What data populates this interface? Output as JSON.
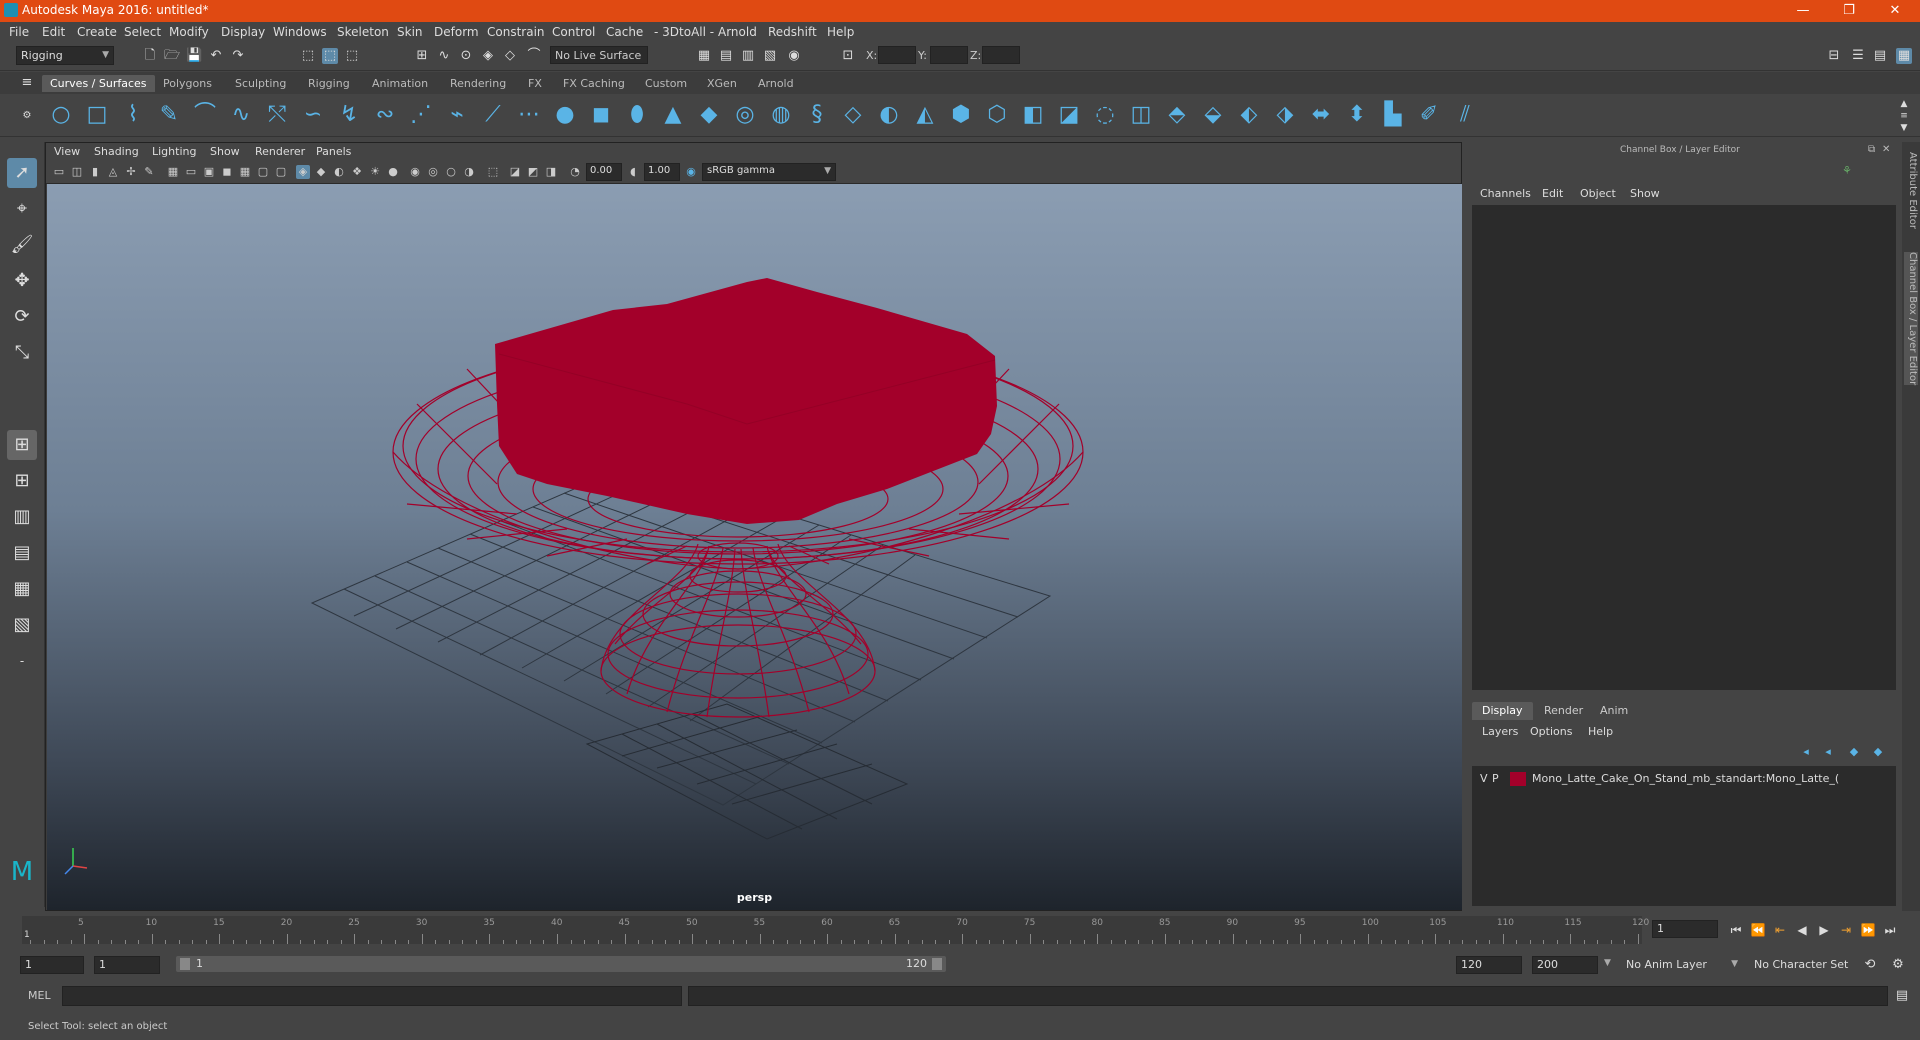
{
  "window": {
    "title": "Autodesk Maya 2016: untitled*",
    "minimize": "—",
    "maximize": "❐",
    "close": "✕"
  },
  "menu": [
    "File",
    "Edit",
    "Create",
    "Select",
    "Modify",
    "Display",
    "Windows",
    "Skeleton",
    "Skin",
    "Deform",
    "Constrain",
    "Control",
    "Cache",
    "- 3DtoAll -",
    "Arnold",
    "Redshift",
    "Help"
  ],
  "statusline": {
    "menuset": "Rigging",
    "live_surface": "No Live Surface",
    "x_label": "X:",
    "y_label": "Y:",
    "z_label": "Z:"
  },
  "shelf": {
    "tabs": [
      "Curves / Surfaces",
      "Polygons",
      "Sculpting",
      "Rigging",
      "Animation",
      "Rendering",
      "FX",
      "FX Caching",
      "Custom",
      "XGen",
      "Arnold"
    ],
    "active_tab": "Curves / Surfaces"
  },
  "viewport": {
    "menu": [
      "View",
      "Shading",
      "Lighting",
      "Show",
      "Renderer",
      "Panels"
    ],
    "exposure": "0.00",
    "gamma": "1.00",
    "color_space": "sRGB gamma",
    "camera_label": "persp"
  },
  "channel_box": {
    "header": "Channel Box / Layer Editor",
    "menu": [
      "Channels",
      "Edit",
      "Object",
      "Show"
    ]
  },
  "layer_editor": {
    "tabs": [
      "Display",
      "Render",
      "Anim"
    ],
    "active_tab": "Display",
    "menu": [
      "Layers",
      "Options",
      "Help"
    ],
    "layer": {
      "v": "V",
      "p": "P",
      "name": "Mono_Latte_Cake_On_Stand_mb_standart:Mono_Latte_(",
      "color": "#a3002a"
    }
  },
  "side_tabs": [
    "Attribute Editor",
    "Channel Box / Layer Editor"
  ],
  "timeslider": {
    "tick_labels": [
      "5",
      "10",
      "15",
      "20",
      "25",
      "30",
      "35",
      "40",
      "45",
      "50",
      "55",
      "60",
      "65",
      "70",
      "75",
      "80",
      "85",
      "90",
      "95",
      "100",
      "105",
      "110",
      "115",
      "120"
    ],
    "start_marker": "1",
    "current_frame": "1"
  },
  "range": {
    "start": "1",
    "playback_start": "1",
    "slider_start": "1",
    "slider_end": "120",
    "playback_end": "120",
    "end": "200",
    "anim_layer": "No Anim Layer",
    "character_set": "No Character Set"
  },
  "cmdline": {
    "label": "MEL"
  },
  "helpline": {
    "text": "Select Tool: select an object"
  },
  "colors": {
    "titlebar": "#e04a12",
    "model": "#a3002a",
    "shelf_icon": "#5ab4e6"
  }
}
